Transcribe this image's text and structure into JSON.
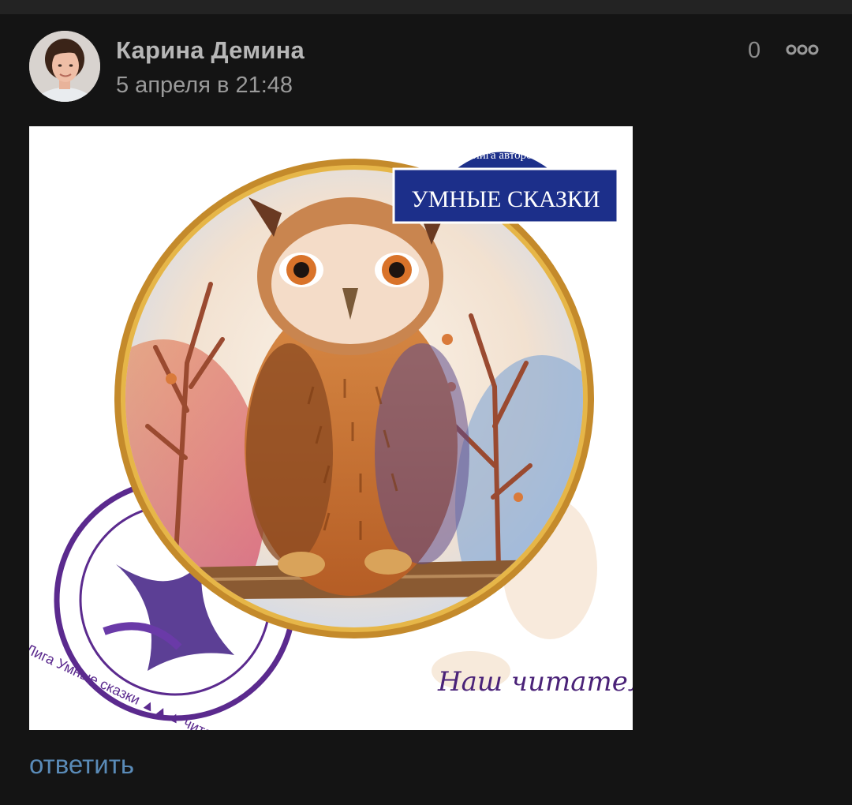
{
  "post": {
    "author": "Карина Демина",
    "timestamp": "5 апреля в 21:48",
    "likes": "0",
    "reply_label": "ответить"
  },
  "attachment": {
    "banner_top": "лига авторов",
    "banner_main": "УМНЫЕ СКАЗКИ",
    "stamp_text": "Лига Умные сказки ▲▲▲ читателю",
    "caption": "Наш читатель"
  },
  "icons": {
    "more": "more-dots-icon",
    "avatar": "avatar"
  },
  "colors": {
    "background": "#141414",
    "author": "#b7b7b7",
    "timestamp": "#9a9a9a",
    "link": "#5a8bb8",
    "banner": "#1c2f8a",
    "stamp": "#5b2a8e"
  }
}
